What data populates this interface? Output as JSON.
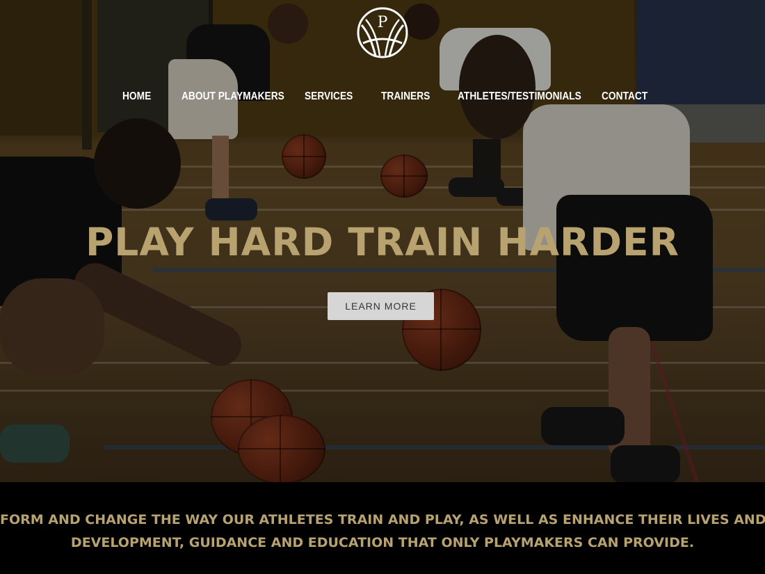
{
  "logo": {
    "letter": "P",
    "icon": "basketball-logo-icon"
  },
  "nav": {
    "items": [
      {
        "label": "HOME"
      },
      {
        "label": "ABOUT PLAYMAKERS"
      },
      {
        "label": "SERVICES"
      },
      {
        "label": "TRAINERS"
      },
      {
        "label": "ATHLETES/TESTIMONIALS"
      },
      {
        "label": "CONTACT"
      }
    ]
  },
  "hero": {
    "headline": "PLAY HARD TRAIN HARDER",
    "cta_label": "LEARN MORE"
  },
  "mission": {
    "line1": "FORM AND CHANGE THE WAY OUR ATHLETES TRAIN AND PLAY, AS WELL AS ENHANCE THEIR LIVES AND CAREERS TH",
    "line2": "DEVELOPMENT, GUIDANCE AND EDUCATION THAT ONLY PLAYMAKERS CAN PROVIDE."
  },
  "colors": {
    "accent_gold": "#b8a270",
    "button_bg": "#d6d6d6",
    "nav_text": "#ffffff",
    "footer_bg": "#000000"
  }
}
